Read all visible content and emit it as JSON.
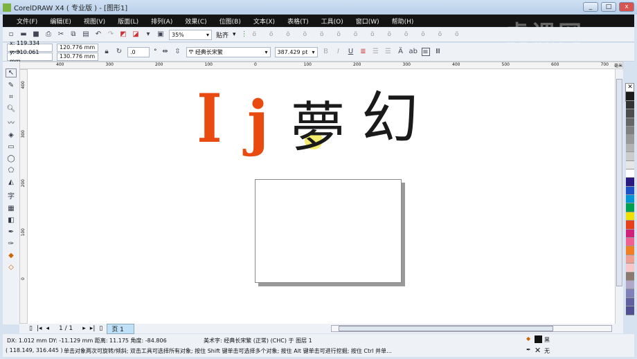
{
  "window": {
    "title": "CorelDRAW X4 ( 专业版 ) - [图形1]",
    "minimize": "_",
    "maximize": "□",
    "close": "x"
  },
  "menu": [
    "文件(F)",
    "编辑(E)",
    "视图(V)",
    "版面(L)",
    "排列(A)",
    "效果(C)",
    "位图(B)",
    "文本(X)",
    "表格(T)",
    "工具(O)",
    "窗口(W)",
    "帮助(H)"
  ],
  "watermark": "虎课网",
  "standard_toolbar": {
    "zoom": "35%",
    "snap": "贴齐"
  },
  "property_bar": {
    "x": "x: 119.334 mm",
    "y": "y: 310.061 mm",
    "width": "120.776 mm",
    "height": "130.776 mm",
    "rotation": ".0",
    "degree": "°",
    "font": "经典长宋繁",
    "font_size": "387.429 pt"
  },
  "ruler": {
    "h_ticks": [
      "400",
      "300",
      "200",
      "100",
      "0",
      "100",
      "200",
      "300",
      "400",
      "500",
      "600",
      "700"
    ],
    "unit": "毫米",
    "v_ticks": [
      "400",
      "300",
      "200",
      "100",
      "0"
    ]
  },
  "canvas": {
    "glyphs": [
      "I",
      "j",
      "夢",
      "幻"
    ],
    "accent": "#e84a10"
  },
  "page_nav": {
    "count": "1 / 1",
    "tab": "页 1"
  },
  "status": {
    "line1": "DX: 1.012 mm DY: -11.129 mm 距离: 11.175 角度: -84.806",
    "object": "美术字: 经典长宋繁 (正常) (CHC) 于 图层 1",
    "coords": "( 118.149, 316.445 )",
    "hint": "单击对象两次可旋转/倾斜; 双击工具可选择所有对象; 按住 Shift 键单击可选择多个对象; 按住 Alt 键单击可进行挖掘; 按住 Ctrl 并单...",
    "fill": "黑",
    "outline": "无"
  },
  "palette": [
    "#1a1a1a",
    "#333",
    "#4d4d4d",
    "#666",
    "#808080",
    "#999",
    "#b3b3b3",
    "#ccc",
    "#e6e6e6",
    "#fff",
    "#2a1a80",
    "#1e50c8",
    "#0096d6",
    "#00a050",
    "#f0e000",
    "#e8401a",
    "#d0207a",
    "#f06090",
    "#f08020",
    "#f0a090",
    "#f8c8c8",
    "#8a7a70",
    "#b0a8c8",
    "#8080b8",
    "#6060a0",
    "#505090"
  ]
}
